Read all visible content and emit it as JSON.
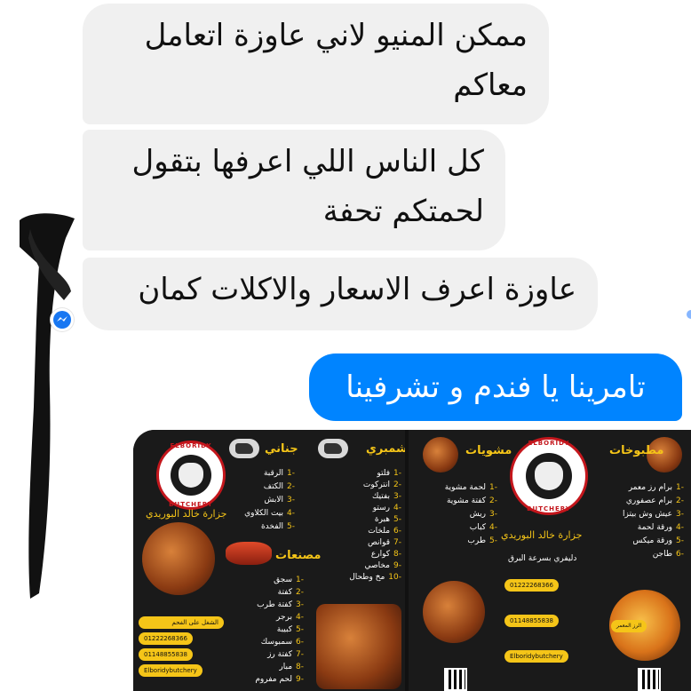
{
  "messages": [
    {
      "direction": "incoming",
      "text": "ممكن المنيو لاني عاوزة اتعامل معاكم"
    },
    {
      "direction": "incoming",
      "text": "كل الناس اللي اعرفها بتقول لحمتكم تحفة"
    },
    {
      "direction": "incoming",
      "text": "عاوزة اعرف الاسعار والاكلات كمان"
    },
    {
      "direction": "outgoing",
      "text": "تامرينا يا فندم و تشرفينا"
    }
  ],
  "menu": {
    "brand_en_top": "ELBORIDY",
    "brand_en_bottom": "BUTCHERY",
    "brand_ar": "جزارة خالد البوريدي",
    "delivery": "دليفري بسرعة البرق",
    "phone": "01222268366",
    "phone2": "01148855838",
    "facebook": "Elboridybutchery",
    "sections_left": [
      "جناني",
      "شمبري",
      "مصنعات"
    ],
    "sections_right": [
      "مشويات",
      "مطبوخات"
    ],
    "items_a": [
      "الرقبة",
      "الكتف",
      "الابش",
      "بيت الكلاوي",
      "الفخدة"
    ],
    "items_b": [
      "فلتو",
      "انتركوت",
      "بفتيك",
      "رستو",
      "هبرة",
      "ملخات",
      "قوانص",
      "كوارع",
      "مخاصي",
      "مخ وطحال"
    ],
    "items_c": [
      "سجق",
      "كفتة",
      "كفتة طرب",
      "برجر",
      "كبيبة",
      "سمبوسك",
      "كفتة رز",
      "مبار",
      "لحم مفروم"
    ],
    "items_d": [
      "لحمة مشوية",
      "كفتة مشوية",
      "ريش",
      "كباب",
      "طرب"
    ],
    "items_e": [
      "برام رز معمر",
      "برام عصفوري",
      "عيش وش بيتزا",
      "ورقة لحمة",
      "ورقة ميكس",
      "طاجن"
    ],
    "promo_a": "الشغل على الفحم",
    "promo_b": "الرز المعمر"
  }
}
